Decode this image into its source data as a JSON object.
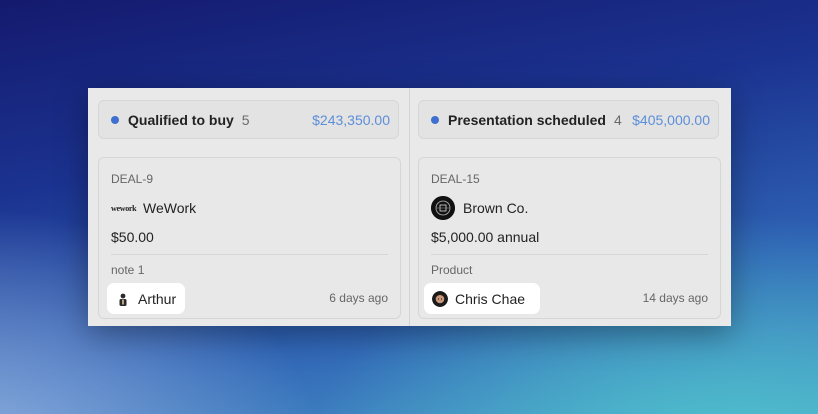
{
  "columns": [
    {
      "stage": "Qualified to buy",
      "count": "5",
      "total": "$243,350.00",
      "card": {
        "deal_id": "DEAL-9",
        "company": "WeWork",
        "logo_text": "wework",
        "amount": "$50.00",
        "note": "note 1",
        "owner": "Arthur",
        "time": "6 days ago"
      }
    },
    {
      "stage": "Presentation scheduled",
      "count": "4",
      "total": "$405,000.00",
      "card": {
        "deal_id": "DEAL-15",
        "company": "Brown Co.",
        "amount": "$5,000.00 annual",
        "note": "Product",
        "owner": "Chris Chae",
        "time": "14 days ago"
      }
    }
  ],
  "colors": {
    "accent": "#3f6fcf",
    "total_text": "#5d8ed9",
    "panel": "#e9e9e9"
  }
}
